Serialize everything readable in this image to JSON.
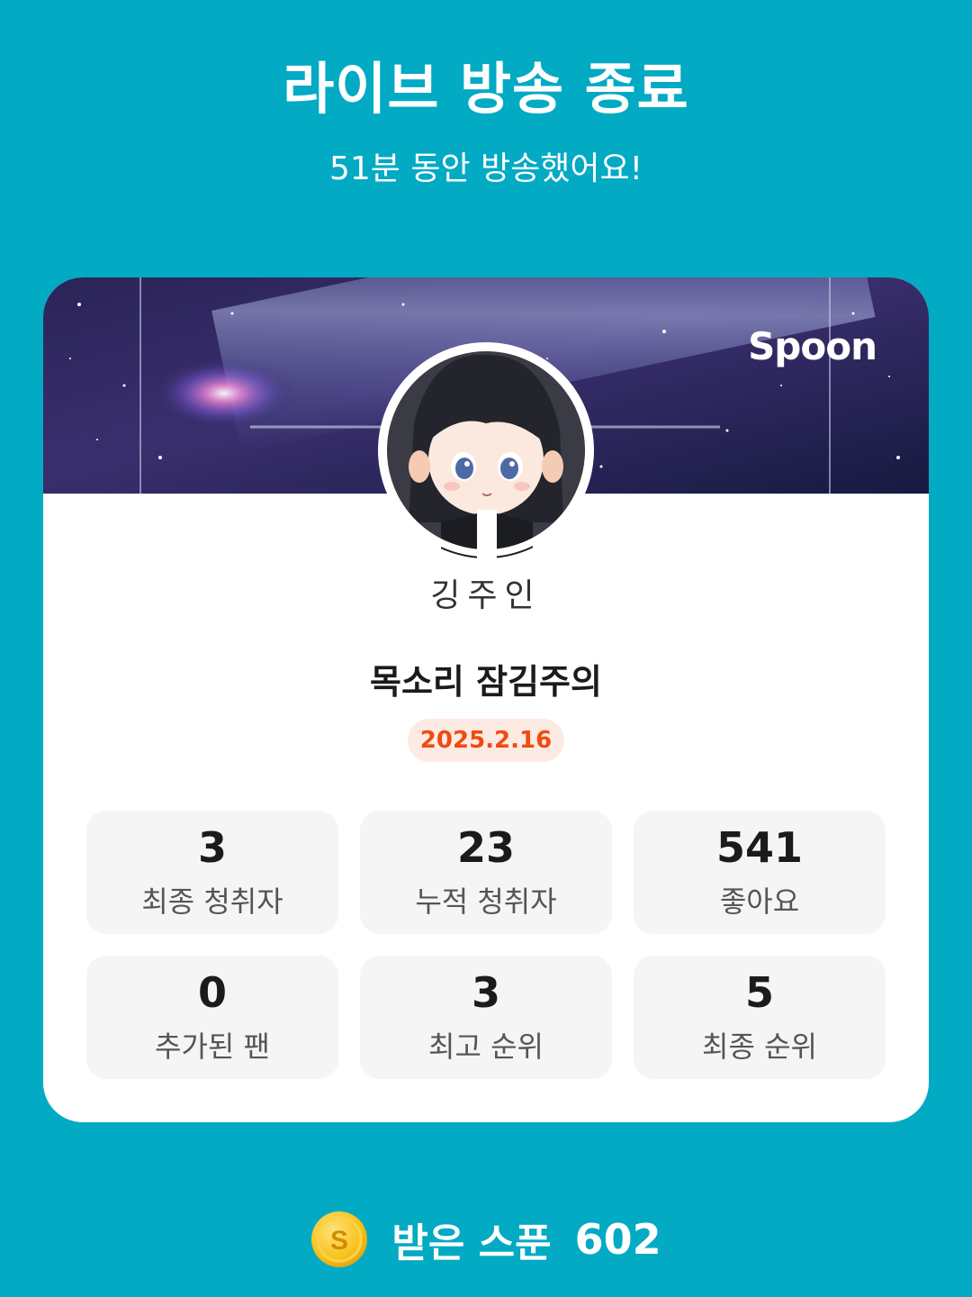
{
  "header": {
    "title": "라이브 방송 종료",
    "subtitle": "51분 동안 방송했어요!"
  },
  "card": {
    "brand": "Spoon",
    "username": "깅주인",
    "room_title": "목소리 잠김주의",
    "date": "2025.2.16",
    "stats": [
      {
        "value": "3",
        "label": "최종 청취자"
      },
      {
        "value": "23",
        "label": "누적 청취자"
      },
      {
        "value": "541",
        "label": "좋아요"
      },
      {
        "value": "0",
        "label": "추가된 팬"
      },
      {
        "value": "3",
        "label": "최고 순위"
      },
      {
        "value": "5",
        "label": "최종 순위"
      }
    ]
  },
  "footer": {
    "coin_letter": "S",
    "label": "받은 스푼",
    "value": "602"
  },
  "colors": {
    "background": "#02aac4",
    "date_text": "#ef4b12",
    "date_badge": "#fdeae3",
    "coin": "#f7c21a"
  }
}
